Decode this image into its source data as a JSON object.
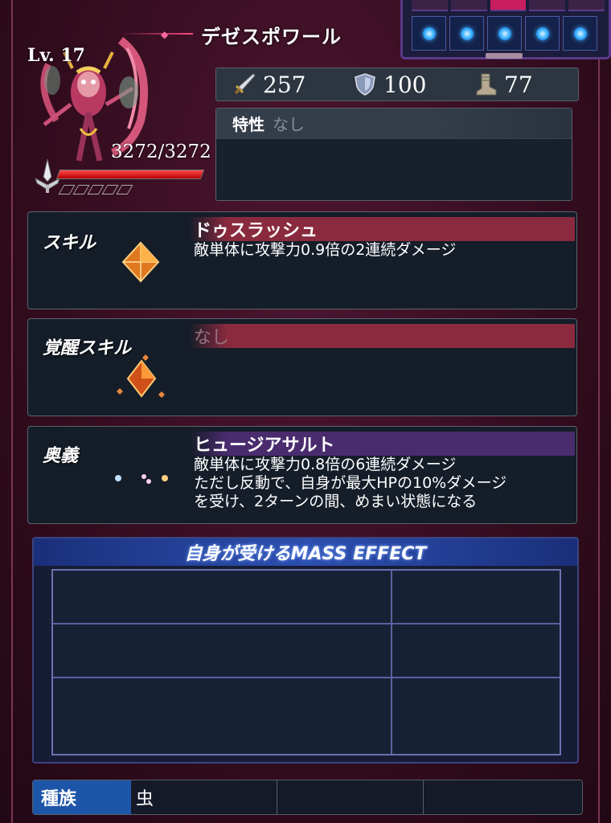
{
  "monster": {
    "name": "デゼスポワール",
    "level": "Lv. 17",
    "hp_text": "3272/3272",
    "hp_fraction": 1.0
  },
  "stats": {
    "attack": "257",
    "defense": "100",
    "speed": "77"
  },
  "trait": {
    "label": "特性",
    "value": "なし"
  },
  "skill": {
    "label": "スキル",
    "name": "ドゥスラッシュ",
    "description": "敵単体に攻撃力0.9倍の2連続ダメージ"
  },
  "awaken_skill": {
    "label": "覚醒スキル",
    "name": "なし"
  },
  "ultimate": {
    "label": "奥義",
    "name": "ヒュージアサルト",
    "description_lines": [
      "敵単体に攻撃力0.8倍の6連続ダメージ",
      "ただし反動で、自身が最大HPの10%ダメージ",
      "を受け、2ターンの間、めまい状態になる"
    ]
  },
  "mass_effect": {
    "title": "自身が受けるMASS EFFECT"
  },
  "tribe": {
    "label": "種族",
    "value": "虫"
  },
  "slots": {
    "count": 5,
    "active_top_index": 2
  },
  "colors": {
    "skill_header": "#8a2a3e",
    "ultimate_header": "#4a2b6e",
    "mass_header": "#2c4fb0",
    "tribe_label": "#1d56a8"
  }
}
